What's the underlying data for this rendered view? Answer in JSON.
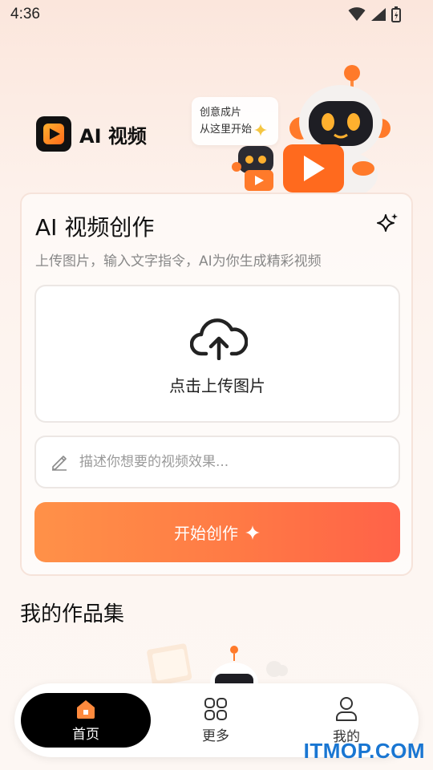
{
  "status_bar": {
    "time": "4:36"
  },
  "brand": {
    "name": "AI 视频"
  },
  "hero": {
    "bubble_line1": "创意成片",
    "bubble_line2": "从这里开始"
  },
  "create_card": {
    "title": "AI 视频创作",
    "subtitle": "上传图片，输入文字指令，AI为你生成精彩视频",
    "upload_label": "点击上传图片",
    "prompt_placeholder": "描述你想要的视频效果...",
    "prompt_value": "",
    "create_button_label": "开始创作"
  },
  "works": {
    "title": "我的作品集"
  },
  "bottom_nav": {
    "items": [
      {
        "label": "首页",
        "icon": "home-icon",
        "active": true
      },
      {
        "label": "更多",
        "icon": "grid-icon",
        "active": false
      },
      {
        "label": "我的",
        "icon": "user-icon",
        "active": false
      }
    ]
  },
  "watermark": {
    "text": "ITMOP.COM"
  },
  "colors": {
    "accent_start": "#ff9148",
    "accent_end": "#ff6248",
    "nav_active_bg": "#000000",
    "watermark": "#1976d2"
  }
}
